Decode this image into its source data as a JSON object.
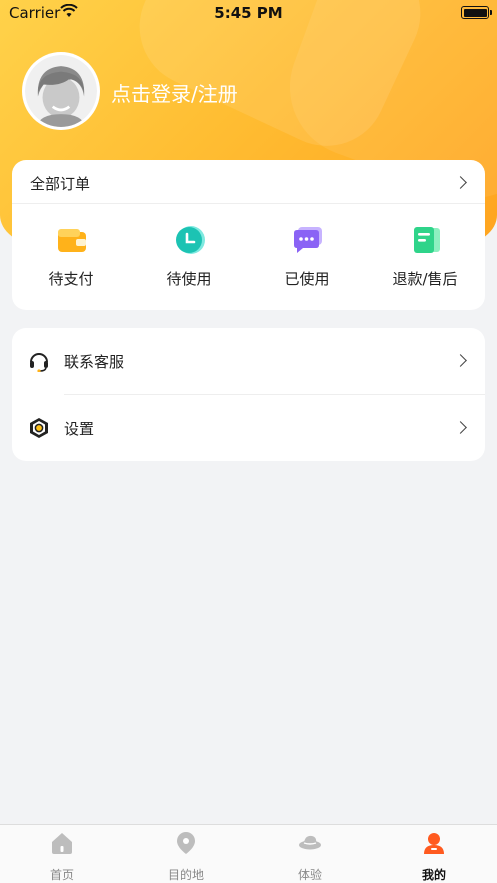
{
  "status_bar": {
    "carrier": "Carrier",
    "time": "5:45 PM"
  },
  "profile": {
    "login_text": "点击登录/注册"
  },
  "orders": {
    "title": "全部订单",
    "items": [
      {
        "label": "待支付",
        "icon": "wallet-icon"
      },
      {
        "label": "待使用",
        "icon": "clock-icon"
      },
      {
        "label": "已使用",
        "icon": "message-icon"
      },
      {
        "label": "退款/售后",
        "icon": "document-icon"
      }
    ]
  },
  "menu": {
    "items": [
      {
        "label": "联系客服",
        "icon": "headset-icon"
      },
      {
        "label": "设置",
        "icon": "settings-icon"
      }
    ]
  },
  "tabbar": {
    "items": [
      {
        "label": "首页",
        "icon": "home-icon"
      },
      {
        "label": "目的地",
        "icon": "location-pin-icon"
      },
      {
        "label": "体验",
        "icon": "hat-icon"
      },
      {
        "label": "我的",
        "icon": "user-icon",
        "active": true
      }
    ]
  },
  "colors": {
    "header_yellow": "#ffc233",
    "active_tab": "#ff5a1f"
  }
}
